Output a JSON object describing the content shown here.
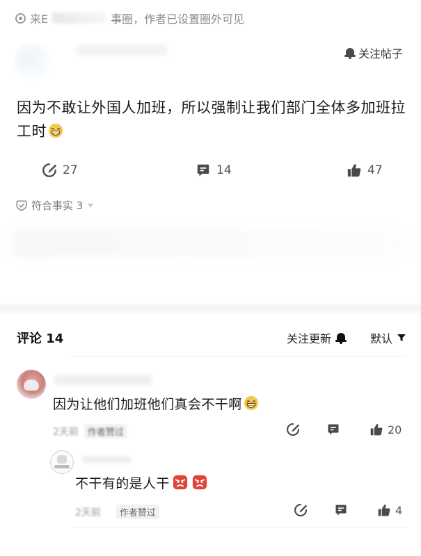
{
  "post": {
    "source_prefix": "来E",
    "source_suffix": "事圈，作者已设置圈外可见",
    "follow_post_label": "关注帖子",
    "text": "因为不敢让外国人加班，所以强制让我们部门全体多加班拉工时",
    "reposts": "27",
    "comments": "14",
    "likes": "47",
    "fact_label": "符合事实 3"
  },
  "comments_section": {
    "title": "评论 14",
    "follow_updates_label": "关注更新",
    "sort_label": "默认"
  },
  "comments": [
    {
      "text": "因为让他们加班他们真会不干啊",
      "time": "2天前",
      "author_liked": "作者赞过",
      "likes": "20"
    },
    {
      "text": "不干有的是人干",
      "time": "2天前",
      "author_liked": "作者赞过",
      "likes": "4"
    }
  ],
  "icons": [
    "gear-ring-icon",
    "bell-icon",
    "repost-icon",
    "comment-icon",
    "thumbs-up-icon",
    "fact-check-icon",
    "filter-sort-icon",
    "grin-sweat-emoji-icon",
    "angry-face-emoji-icon"
  ],
  "colors": {
    "icon": "#4a4a4a",
    "muted_text": "#9a9a9a",
    "emoji_yellow": "#f7c948",
    "angry_red": "#e0443a"
  }
}
